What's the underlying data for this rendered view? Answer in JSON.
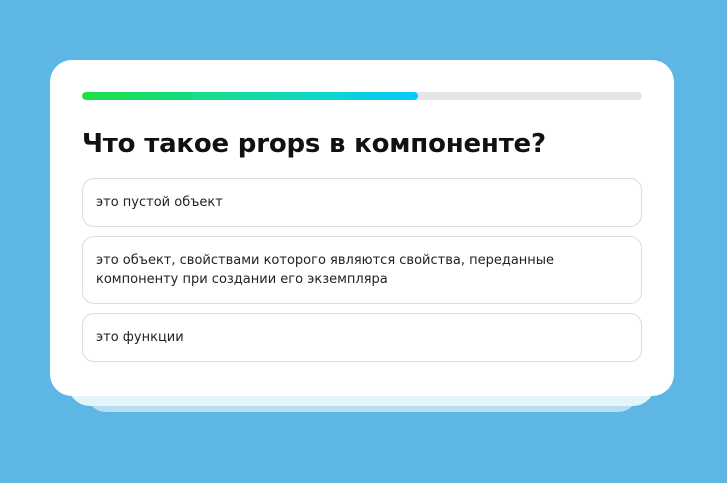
{
  "quiz": {
    "progress_percent": 60,
    "question": "Что такое props в компоненте?",
    "answers": [
      {
        "label": "это пустой объект"
      },
      {
        "label": "это объект, свойствами которого являются свойства, переданные компоненту при создании его экземпляра"
      },
      {
        "label": "это функции"
      }
    ]
  },
  "colors": {
    "background": "#5db6e3",
    "card": "#ffffff",
    "progress_start": "#1ddf45",
    "progress_end": "#06c8ff",
    "progress_track": "#e6e6e6"
  }
}
